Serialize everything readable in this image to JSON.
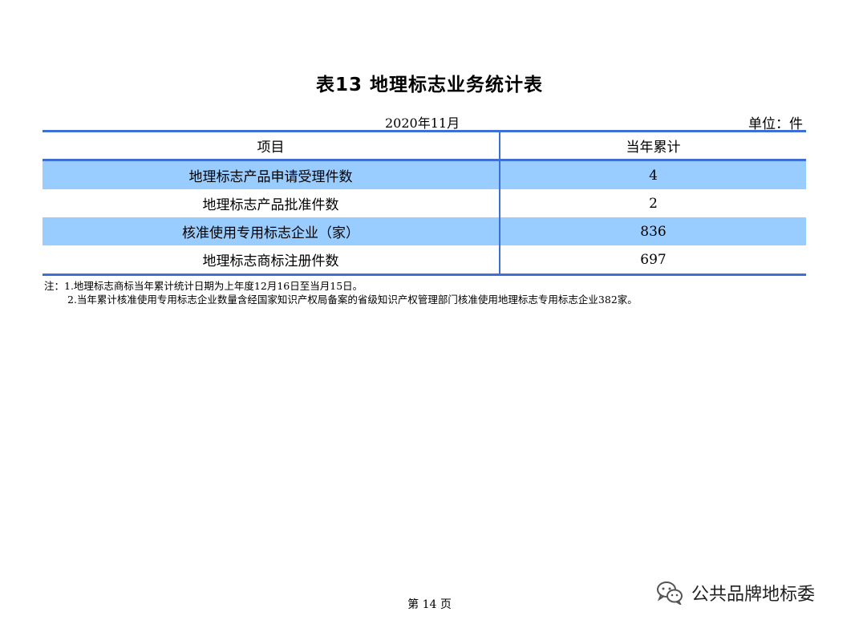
{
  "title": "表13 地理标志业务统计表",
  "meta": {
    "date": "2020年11月",
    "unit": "单位：件"
  },
  "table": {
    "headers": [
      "项目",
      "当年累计"
    ],
    "rows": [
      {
        "item": "地理标志产品申请受理件数",
        "value": "4"
      },
      {
        "item": "地理标志产品批准件数",
        "value": "2"
      },
      {
        "item": "核准使用专用标志企业（家）",
        "value": "836"
      },
      {
        "item": "地理标志商标注册件数",
        "value": "697"
      }
    ]
  },
  "notes": [
    "注：1.地理标志商标当年累计统计日期为上年度12月16日至当月15日。",
    "2.当年累计核准使用专用标志企业数量含经国家知识产权局备案的省级知识产权管理部门核准使用地理标志专用标志企业382家。"
  ],
  "footer": {
    "page": "第 14 页",
    "watermark": "公共品牌地标委",
    "icon": "wechat-icon"
  },
  "colors": {
    "border": "#3d6fd6",
    "shaded_row": "#99ccff"
  }
}
